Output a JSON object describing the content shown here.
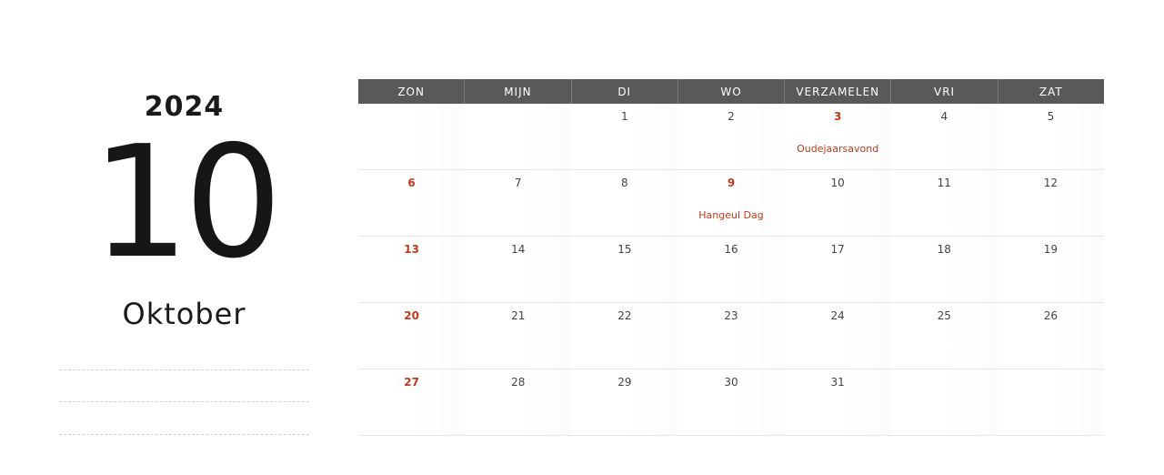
{
  "year": "2024",
  "month_number": "10",
  "month_name": "Oktober",
  "colors": {
    "header_bg": "#595959",
    "holiday": "#c0391b"
  },
  "weekdays": [
    "ZON",
    "MIJN",
    "DI",
    "WO",
    "VERZAMELEN",
    "VRI",
    "ZAT"
  ],
  "weeks": [
    [
      {
        "day": "",
        "red": false,
        "event": ""
      },
      {
        "day": "",
        "red": false,
        "event": ""
      },
      {
        "day": "1",
        "red": false,
        "event": ""
      },
      {
        "day": "2",
        "red": false,
        "event": ""
      },
      {
        "day": "3",
        "red": true,
        "event": "Oudejaarsavond"
      },
      {
        "day": "4",
        "red": false,
        "event": ""
      },
      {
        "day": "5",
        "red": false,
        "event": ""
      }
    ],
    [
      {
        "day": "6",
        "red": true,
        "event": ""
      },
      {
        "day": "7",
        "red": false,
        "event": ""
      },
      {
        "day": "8",
        "red": false,
        "event": ""
      },
      {
        "day": "9",
        "red": true,
        "event": "Hangeul Dag"
      },
      {
        "day": "10",
        "red": false,
        "event": ""
      },
      {
        "day": "11",
        "red": false,
        "event": ""
      },
      {
        "day": "12",
        "red": false,
        "event": ""
      }
    ],
    [
      {
        "day": "13",
        "red": true,
        "event": ""
      },
      {
        "day": "14",
        "red": false,
        "event": ""
      },
      {
        "day": "15",
        "red": false,
        "event": ""
      },
      {
        "day": "16",
        "red": false,
        "event": ""
      },
      {
        "day": "17",
        "red": false,
        "event": ""
      },
      {
        "day": "18",
        "red": false,
        "event": ""
      },
      {
        "day": "19",
        "red": false,
        "event": ""
      }
    ],
    [
      {
        "day": "20",
        "red": true,
        "event": ""
      },
      {
        "day": "21",
        "red": false,
        "event": ""
      },
      {
        "day": "22",
        "red": false,
        "event": ""
      },
      {
        "day": "23",
        "red": false,
        "event": ""
      },
      {
        "day": "24",
        "red": false,
        "event": ""
      },
      {
        "day": "25",
        "red": false,
        "event": ""
      },
      {
        "day": "26",
        "red": false,
        "event": ""
      }
    ],
    [
      {
        "day": "27",
        "red": true,
        "event": ""
      },
      {
        "day": "28",
        "red": false,
        "event": ""
      },
      {
        "day": "29",
        "red": false,
        "event": ""
      },
      {
        "day": "30",
        "red": false,
        "event": ""
      },
      {
        "day": "31",
        "red": false,
        "event": ""
      },
      {
        "day": "",
        "red": false,
        "event": ""
      },
      {
        "day": "",
        "red": false,
        "event": ""
      }
    ]
  ]
}
